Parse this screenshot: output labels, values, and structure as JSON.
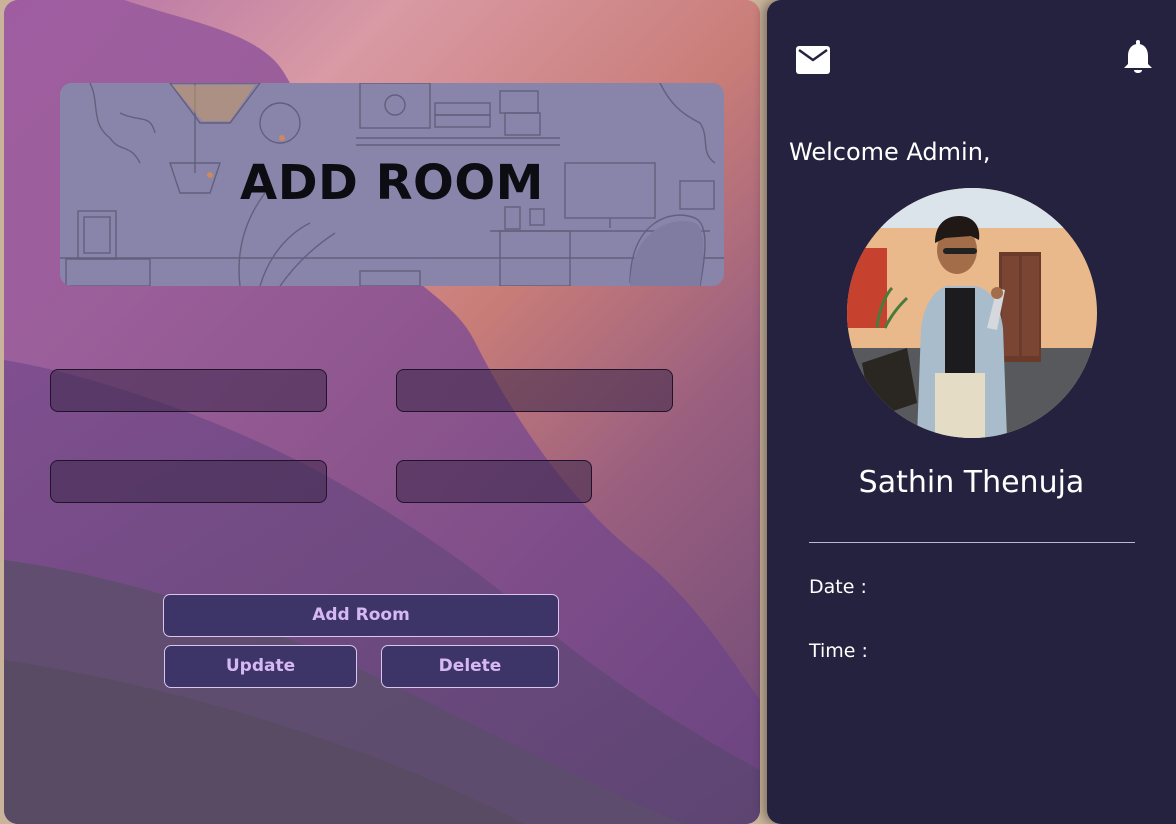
{
  "banner": {
    "title": "ADD ROOM"
  },
  "form": {
    "fields": [
      {
        "value": "",
        "placeholder": ""
      },
      {
        "value": "",
        "placeholder": ""
      },
      {
        "value": "",
        "placeholder": ""
      },
      {
        "value": "",
        "placeholder": ""
      }
    ],
    "add_label": "Add Room",
    "update_label": "Update",
    "delete_label": "Delete"
  },
  "sidebar": {
    "mail_icon": "mail-icon",
    "bell_icon": "bell-icon",
    "welcome": "Welcome Admin,",
    "user_name": "Sathin Thenuja",
    "date_label": "Date :",
    "time_label": "Time :"
  },
  "colors": {
    "sidebar_bg": "#252240",
    "button_bg": "#3d3468",
    "button_text": "#d6b9f2",
    "button_border": "#d9c5ee"
  }
}
